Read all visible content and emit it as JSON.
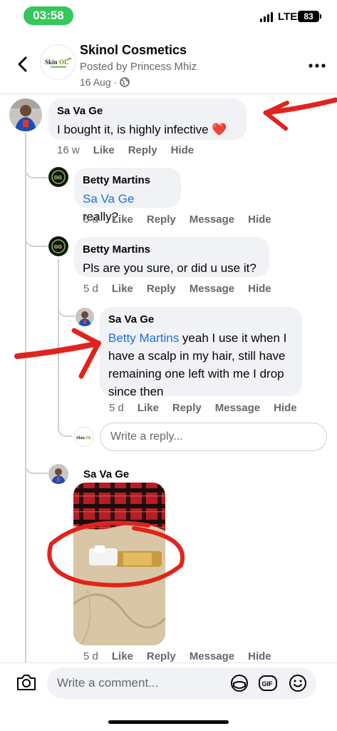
{
  "status_bar": {
    "time": "03:58",
    "network": "LTE",
    "battery": "83"
  },
  "header": {
    "page_name": "Skinol Cosmetics",
    "posted_by": "Posted by Princess Mhiz",
    "date": "16 Aug",
    "date_separator": "·",
    "logo_text": "SkinOL"
  },
  "comments": [
    {
      "author": "Sa Va Ge",
      "text": "I bought it, is highly infective",
      "emoji": "❤️",
      "age": "16 w",
      "actions": [
        "Like",
        "Reply",
        "Hide"
      ]
    },
    {
      "author": "Betty Martins",
      "mention": "Sa Va Ge",
      "text": " really?",
      "age": "5 d",
      "actions": [
        "Like",
        "Reply",
        "Message",
        "Hide"
      ]
    },
    {
      "author": "Betty Martins",
      "text": "Pls are you sure, or did u use it?",
      "age": "5 d",
      "actions": [
        "Like",
        "Reply",
        "Message",
        "Hide"
      ]
    },
    {
      "author": "Sa Va Ge",
      "mention": "Betty Martins",
      "text": " yeah I use it when I have a scalp in my hair, still have remaining one left with me I drop since then",
      "age": "5 d",
      "actions": [
        "Like",
        "Reply",
        "Message",
        "Hide"
      ]
    },
    {
      "author": "Sa Va Ge",
      "age": "5 d",
      "actions": [
        "Like",
        "Reply",
        "Message",
        "Hide"
      ]
    }
  ],
  "reply_box": {
    "placeholder": "Write a reply...",
    "avatar_text": "SkinOL"
  },
  "composer": {
    "placeholder": "Write a comment...",
    "gif_label": "GIF"
  },
  "colors": {
    "accent": "#216fdb",
    "bubble": "#f0f2f5",
    "annotation": "#e0231c",
    "status_green": "#34c759"
  }
}
